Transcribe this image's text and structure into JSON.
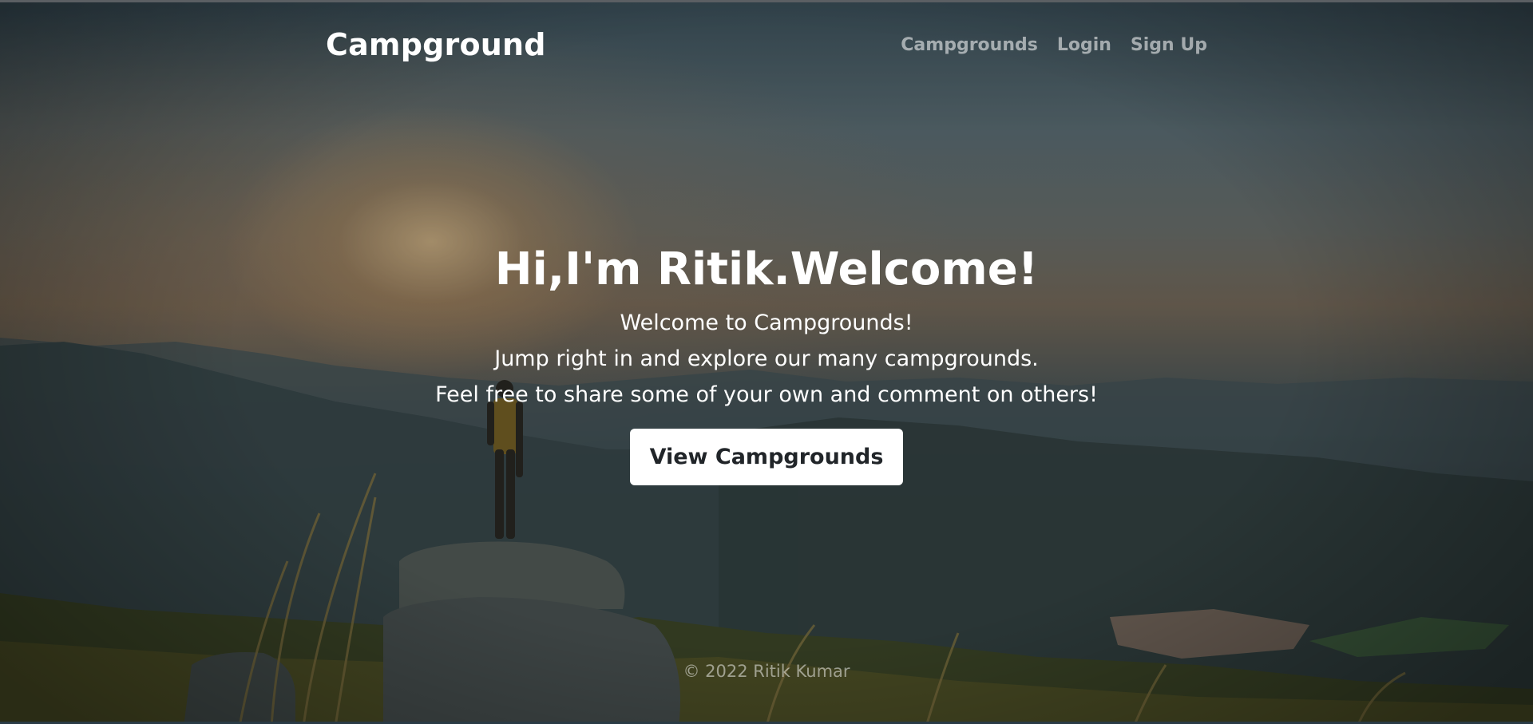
{
  "nav": {
    "brand": "Campground",
    "links": [
      {
        "label": "Campgrounds"
      },
      {
        "label": "Login"
      },
      {
        "label": "Sign Up"
      }
    ]
  },
  "hero": {
    "title": "Hi,I'm Ritik.Welcome!",
    "lines": [
      "Welcome to Campgrounds!",
      "Jump right in and explore our many campgrounds.",
      "Feel free to share some of your own and comment on others!"
    ],
    "cta_label": "View Campgrounds"
  },
  "footer": {
    "text": "© 2022 Ritik Kumar"
  },
  "colors": {
    "nav_link": "#ffffff8c",
    "cta_bg": "#ffffff",
    "cta_text": "#212529"
  },
  "background": {
    "icon": "mountain-sunset-hiker-image"
  }
}
